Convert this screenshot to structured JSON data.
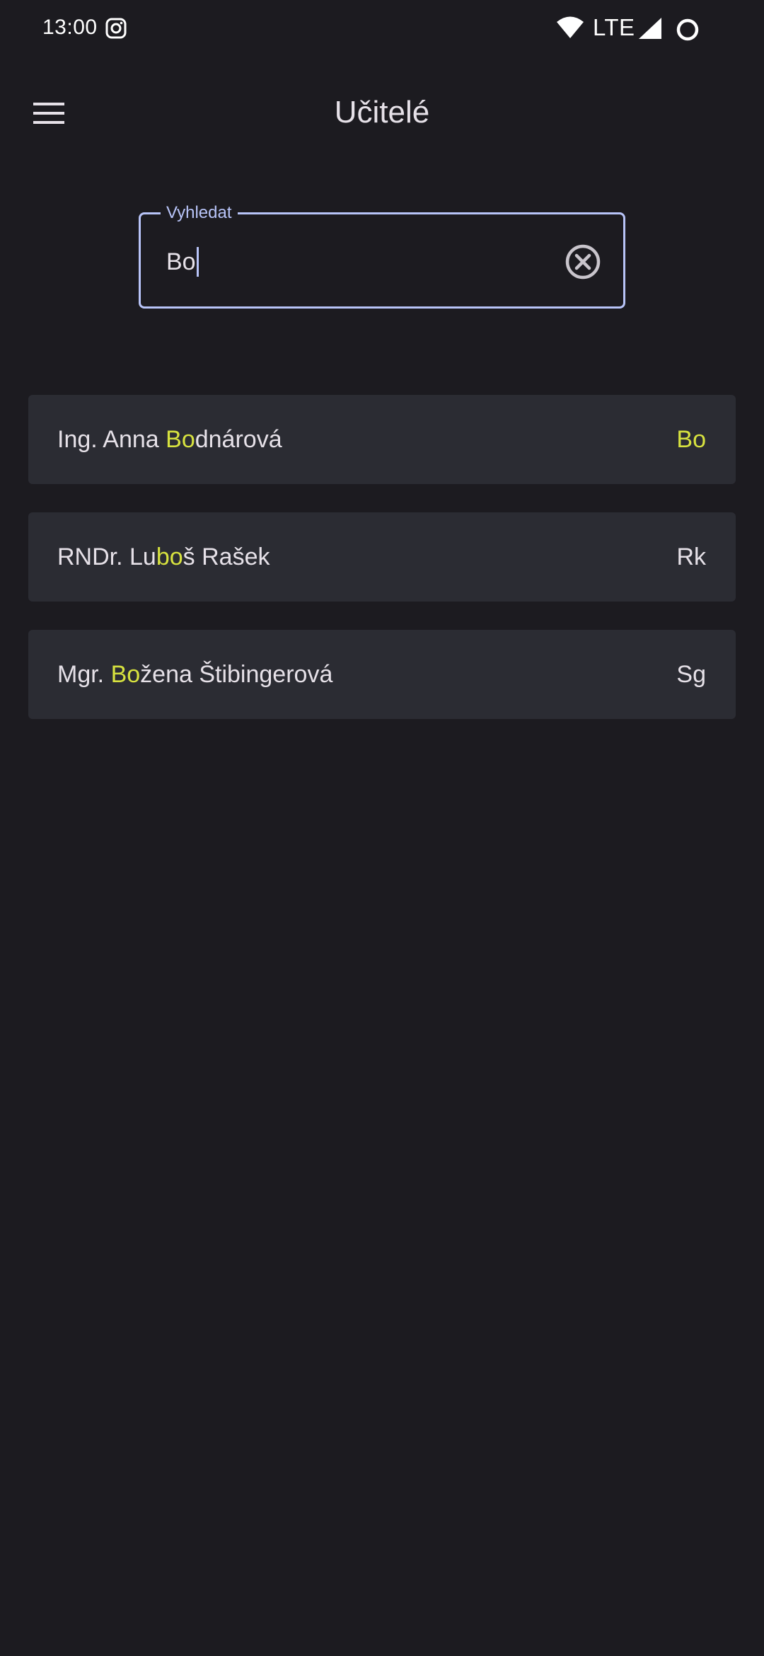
{
  "status_bar": {
    "time": "13:00",
    "network": "LTE",
    "icons": [
      "instagram-icon",
      "wifi-icon",
      "signal-icon",
      "battery-icon"
    ]
  },
  "app_bar": {
    "title": "Učitelé",
    "menu_icon": "hamburger-menu-icon"
  },
  "search": {
    "label": "Vyhledat",
    "value": "Bo",
    "clear_icon": "clear-circle-icon"
  },
  "teachers": [
    {
      "name_before": "Ing. Anna ",
      "name_match": "Bo",
      "name_after": "dnárová",
      "abbr": "Bo"
    },
    {
      "name_before": "RNDr. Lu",
      "name_match": "bo",
      "name_after": "š Rašek",
      "abbr": "Rk"
    },
    {
      "name_before": "Mgr. ",
      "name_match": "Bo",
      "name_after": "žena Štibingerová",
      "abbr": "Sg"
    }
  ],
  "colors": {
    "background": "#1c1b20",
    "card": "#2b2c33",
    "accent": "#b8c4f8",
    "highlight": "#d7e23f",
    "text": "#e6e1e8"
  }
}
